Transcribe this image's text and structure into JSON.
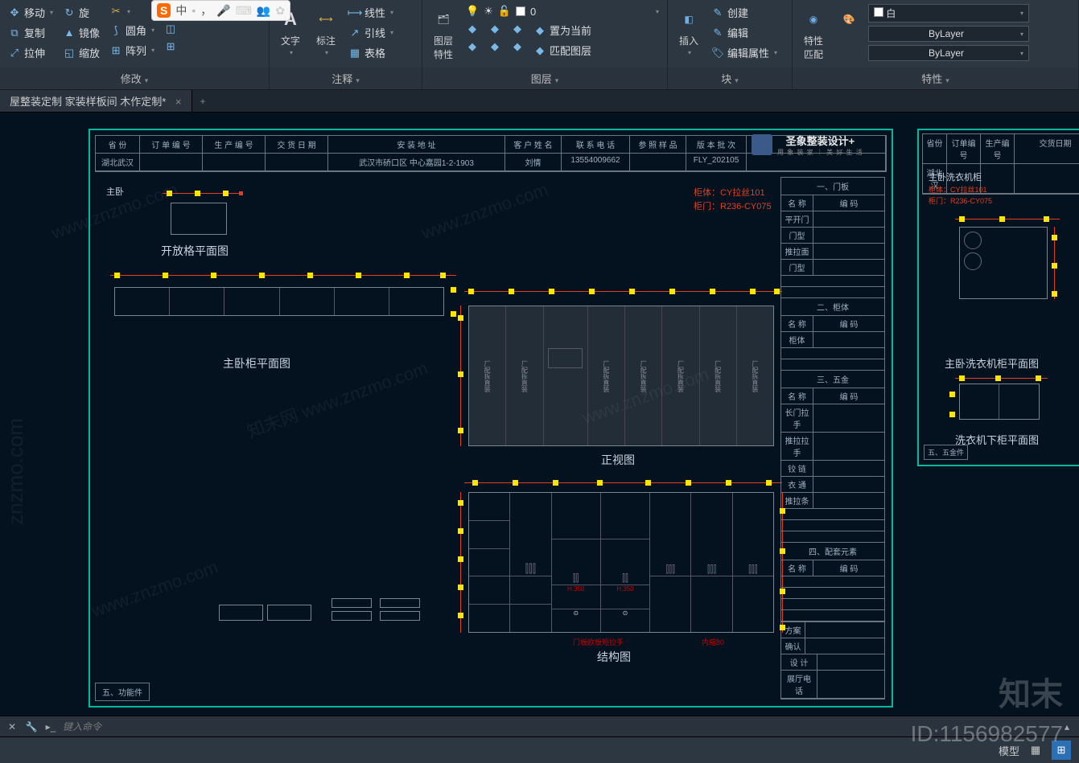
{
  "ribbon": {
    "modify": {
      "title": "修改",
      "move": "移动",
      "rotate": "旋",
      "copy": "复制",
      "mirror": "镜像",
      "fillet": "圆角",
      "stretch": "拉伸",
      "scale": "缩放",
      "array": "阵列"
    },
    "annot": {
      "title": "注释",
      "text": "文字",
      "dim": "标注",
      "linear": "线性",
      "leader": "引线",
      "table": "表格"
    },
    "layer": {
      "title": "图层",
      "layerprop": "图层\n特性",
      "current": "置为当前",
      "match": "匹配图层",
      "zero": "0"
    },
    "insert": {
      "title": "块",
      "insert": "插入",
      "create": "创建",
      "edit": "编辑",
      "attr": "编辑属性"
    },
    "prop": {
      "title": "特性",
      "propbtn": "特性\n匹配",
      "color": "白",
      "bylayer": "ByLayer"
    }
  },
  "tab": {
    "name": "屋整装定制 家装样板间 木作定制*"
  },
  "title_block": {
    "headers": [
      "省 份",
      "订 单 编 号",
      "生 产 编 号",
      "交 货 日 期",
      "安 装 地 址",
      "客 户 姓 名",
      "联 系 电 话",
      "参 照 样 品",
      "版 本 批 次"
    ],
    "row": [
      "湖北武汉",
      "",
      "",
      "",
      "武汉市硚口区 中心嘉园1-2-1903",
      "刘情",
      "13554009662",
      "",
      "FLY_202105"
    ],
    "company": "圣象整装设计+",
    "slogan": "用 象 装 家 ｜ 美 好 生 活"
  },
  "labels": {
    "bedroom": "主卧",
    "shelf_plan": "开放格平面图",
    "cabinet_plan": "主卧柜平面图",
    "elevation": "正视图",
    "structure": "结构图",
    "washer_title": "主卧洗衣机柜",
    "washer_plan": "主卧洗衣机柜平面图",
    "washer_lower": "洗衣机下柜平面图",
    "func": "五、功能件",
    "wujin_sec": "五、五金件",
    "handle_note": "门板欧板短拉手",
    "inset": "内缩80",
    "drawer350": "H:350"
  },
  "red_notes": {
    "body": "柜体：CY拉丝101",
    "door": "柜门：R236-CY075"
  },
  "right_table": {
    "sec1": "一、门板",
    "sec2": "二、柜体",
    "sec3": "三、五金",
    "sec4": "四、配套元素",
    "h_name": "名 称",
    "h_code": "编    码",
    "r1": "平开门",
    "r2": "门型",
    "r3": "推拉面",
    "r4": "门型",
    "r5": "柜体",
    "w1": "长门拉手",
    "w2": "推拉拉手",
    "w3": "铰 链",
    "w4": "衣 通",
    "w5": "推拉条",
    "plan": "方案",
    "confirm": "确认",
    "design": "设 计",
    "phone": "展厅电话"
  },
  "cmd": {
    "placeholder": "键入命令"
  },
  "status": {
    "model": "模型",
    "id": "ID:1156982577",
    "brand": "知末"
  }
}
